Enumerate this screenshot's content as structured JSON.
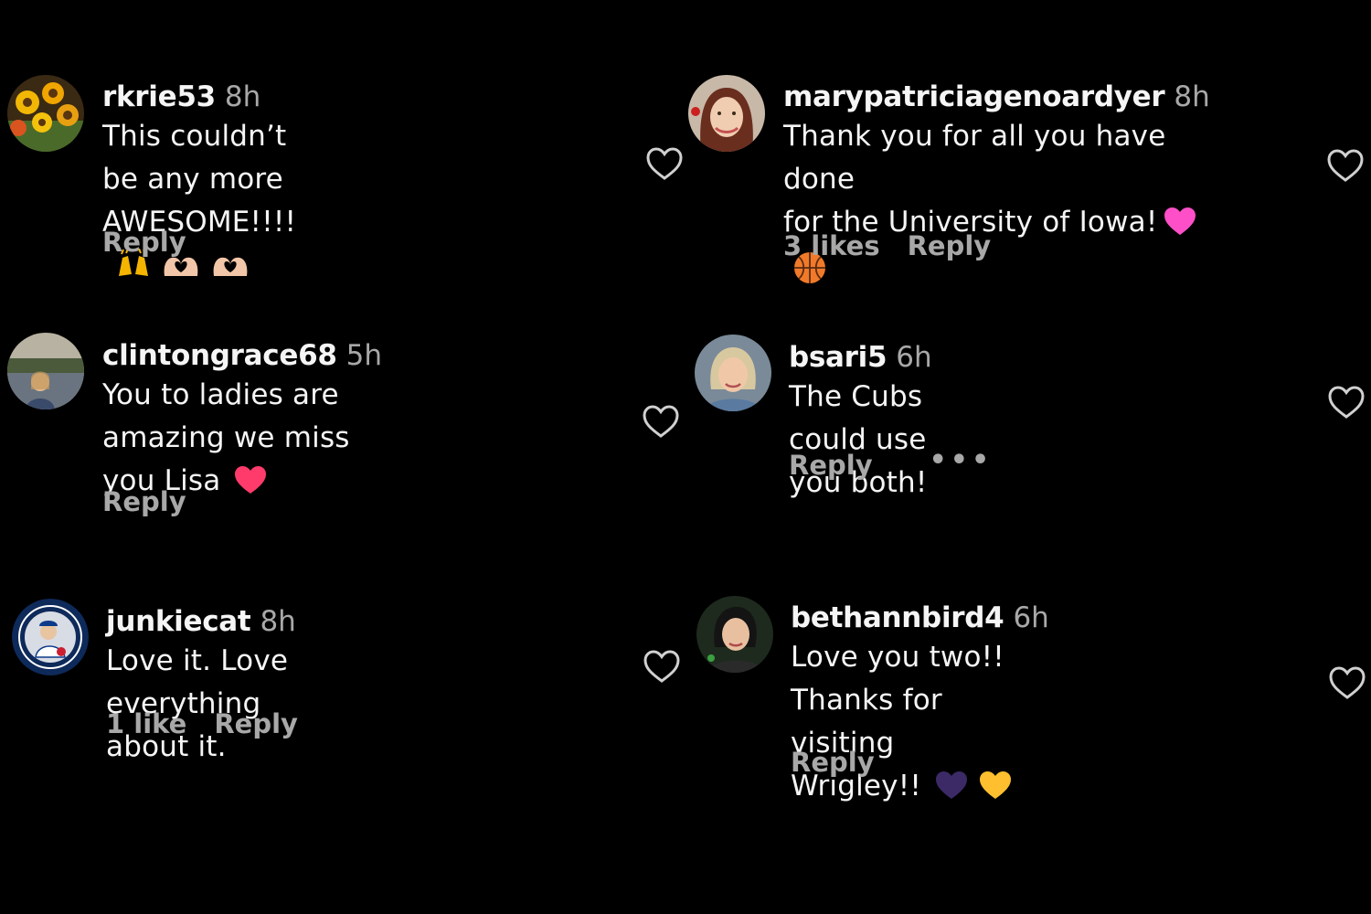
{
  "comments": [
    {
      "username": "rkrie53",
      "time": "8h",
      "text_lines": [
        "This couldn’t be any more",
        "AWESOME!!!!"
      ],
      "likes": "",
      "reply": "Reply",
      "avatar": "sunflowers-avatar",
      "emojis": [
        "raising-hands-emoji",
        "heart-hands-emoji",
        "heart-hands-emoji"
      ]
    },
    {
      "username": "clintongrace68",
      "time": "5h",
      "text_lines": [
        "You to ladies are amazing we miss",
        "you Lisa"
      ],
      "likes": "",
      "reply": "Reply",
      "avatar": "lake-portrait-avatar",
      "emojis": [
        "red-heart-emoji"
      ]
    },
    {
      "username": "junkiecat",
      "time": "8h",
      "text_lines": [
        "Love it. Love everything about it."
      ],
      "likes": "1 like",
      "reply": "Reply",
      "avatar": "baseball-badge-avatar",
      "emojis": []
    },
    {
      "username": "marypatriciagenoardyer",
      "time": "8h",
      "text_lines": [
        "Thank you for all you have done",
        "for the University of Iowa!"
      ],
      "likes": "3 likes",
      "reply": "Reply",
      "avatar": "woman-portrait-avatar",
      "emojis": [
        "pink-heart-emoji",
        "basketball-emoji"
      ]
    },
    {
      "username": "bsari5",
      "time": "6h",
      "text_lines": [
        "The Cubs could use you both!"
      ],
      "likes": "",
      "reply": "Reply",
      "more": "•••",
      "avatar": "blonde-woman-avatar",
      "emojis": []
    },
    {
      "username": "bethannbird4",
      "time": "6h",
      "text_lines": [
        "Love you two!! Thanks for visiting",
        "Wrigley!!"
      ],
      "likes": "",
      "reply": "Reply",
      "avatar": "dark-hair-woman-avatar",
      "emojis": [
        "purple-heart-emoji",
        "yellow-heart-emoji"
      ]
    }
  ],
  "colors": {
    "background": "#000000",
    "primary_text": "#f5f5f5",
    "secondary_text": "#a8a8a8",
    "red_heart": "#ff3b6b",
    "pink_heart": "#ff4fc8",
    "purple_heart": "#3b2a66",
    "yellow_heart": "#ffbf2e"
  }
}
